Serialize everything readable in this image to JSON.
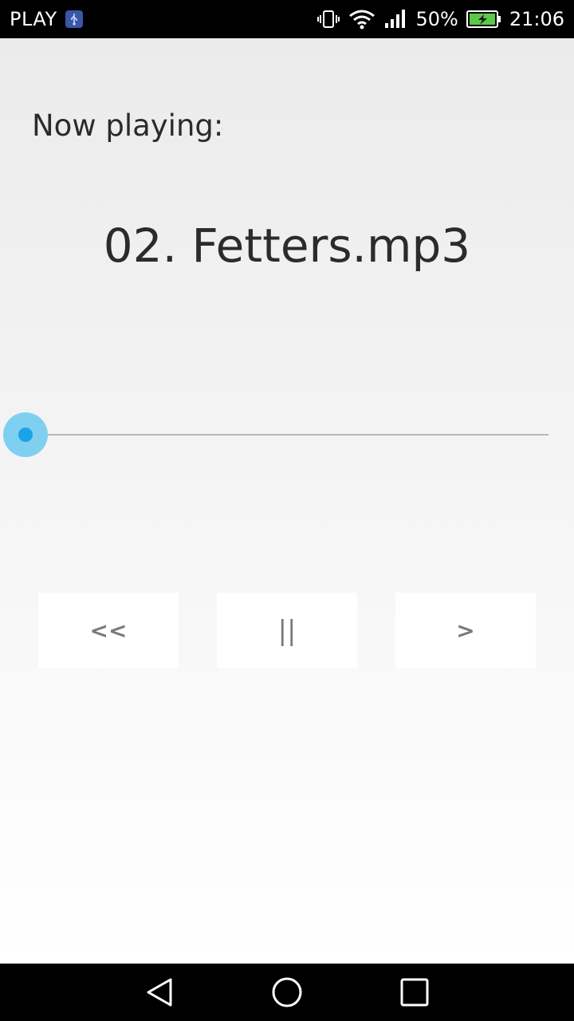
{
  "status_bar": {
    "carrier": "PLAY",
    "usb_icon": "usb-icon",
    "battery_percent": "50%",
    "time": "21:06"
  },
  "player": {
    "now_playing_label": "Now playing:",
    "track_title": "02. Fetters.mp3",
    "progress": 0.0
  },
  "controls": {
    "prev_label": "<<",
    "pause_label": "||",
    "next_label": ">"
  },
  "nav": {
    "back_icon": "back-triangle-icon",
    "home_icon": "home-circle-icon",
    "recent_icon": "recent-square-icon"
  },
  "colors": {
    "accent": "#1aa3e6",
    "thumb_halo": "#7fd0f0"
  }
}
